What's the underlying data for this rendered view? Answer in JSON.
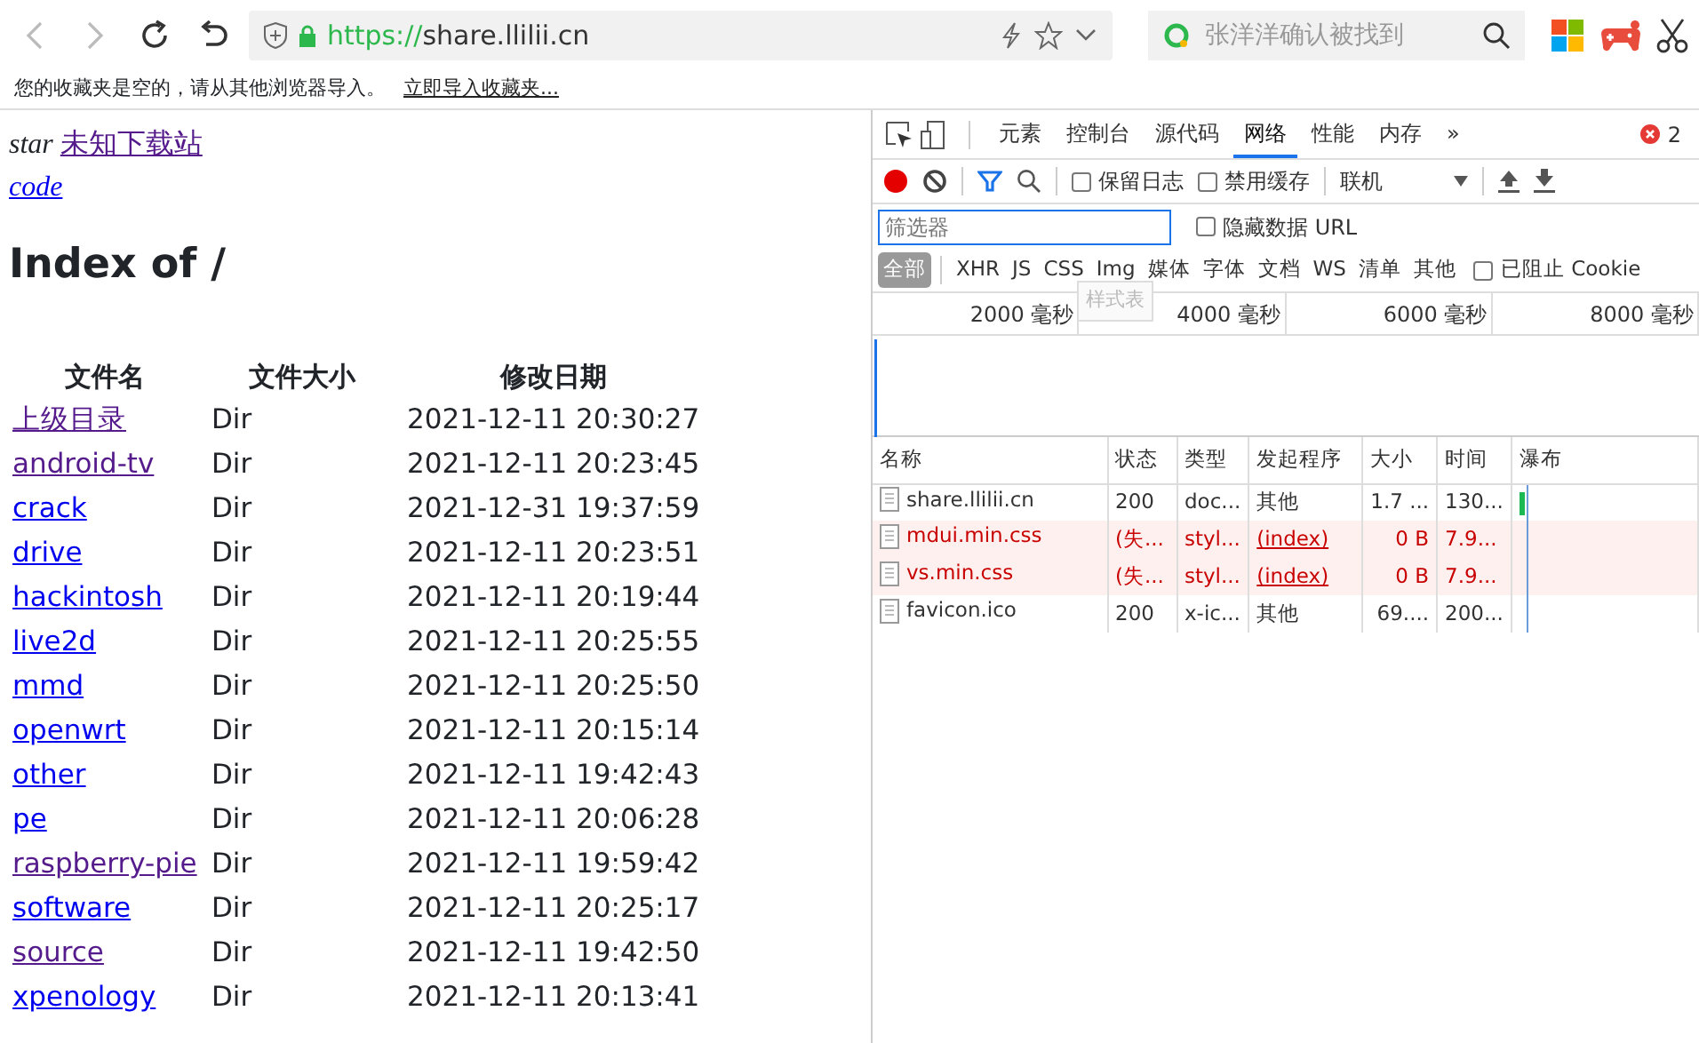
{
  "browser": {
    "url_scheme": "https://",
    "url_host": "share.llilii.cn",
    "search_placeholder": "张洋洋确认被找到"
  },
  "bookmarks_bar": {
    "message": "您的收藏夹是空的，请从其他浏览器导入。",
    "link": "立即导入收藏夹..."
  },
  "page": {
    "intro_text": "star",
    "intro_link": {
      "text": "未知下载站",
      "visited": true
    },
    "code_link": {
      "text": "code",
      "visited": false
    },
    "heading": "Index of /",
    "columns": [
      "文件名",
      "文件大小",
      "修改日期"
    ],
    "rows": [
      {
        "name": "上级目录",
        "visited": true,
        "size": "Dir",
        "date": "2021-12-11 20:30:27"
      },
      {
        "name": "android-tv",
        "visited": true,
        "size": "Dir",
        "date": "2021-12-11 20:23:45"
      },
      {
        "name": "crack",
        "visited": false,
        "size": "Dir",
        "date": "2021-12-31 19:37:59"
      },
      {
        "name": "drive",
        "visited": false,
        "size": "Dir",
        "date": "2021-12-11 20:23:51"
      },
      {
        "name": "hackintosh",
        "visited": false,
        "size": "Dir",
        "date": "2021-12-11 20:19:44"
      },
      {
        "name": "live2d",
        "visited": false,
        "size": "Dir",
        "date": "2021-12-11 20:25:55"
      },
      {
        "name": "mmd",
        "visited": false,
        "size": "Dir",
        "date": "2021-12-11 20:25:50"
      },
      {
        "name": "openwrt",
        "visited": false,
        "size": "Dir",
        "date": "2021-12-11 20:15:14"
      },
      {
        "name": "other",
        "visited": false,
        "size": "Dir",
        "date": "2021-12-11 19:42:43"
      },
      {
        "name": "pe",
        "visited": false,
        "size": "Dir",
        "date": "2021-12-11 20:06:28"
      },
      {
        "name": "raspberry-pie",
        "visited": true,
        "size": "Dir",
        "date": "2021-12-11 19:59:42"
      },
      {
        "name": "software",
        "visited": false,
        "size": "Dir",
        "date": "2021-12-11 20:25:17"
      },
      {
        "name": "source",
        "visited": true,
        "size": "Dir",
        "date": "2021-12-11 19:42:50"
      },
      {
        "name": "xpenology",
        "visited": false,
        "size": "Dir",
        "date": "2021-12-11 20:13:41"
      }
    ]
  },
  "devtools": {
    "tabs": [
      {
        "label": "元素",
        "selected": false
      },
      {
        "label": "控制台",
        "selected": false
      },
      {
        "label": "源代码",
        "selected": false
      },
      {
        "label": "网络",
        "selected": true
      },
      {
        "label": "性能",
        "selected": false
      },
      {
        "label": "内存",
        "selected": false
      }
    ],
    "more": "»",
    "error_count": "2",
    "preserve_log": {
      "label": "保留日志",
      "checked": false
    },
    "disable_cache": {
      "label": "禁用缓存",
      "checked": false
    },
    "throttle": "联机",
    "filter_placeholder": "筛选器",
    "hide_data_urls": {
      "label": "隐藏数据 URL",
      "checked": false
    },
    "type_filters": [
      {
        "label": "全部",
        "selected": true
      },
      {
        "label": "XHR",
        "selected": false
      },
      {
        "label": "JS",
        "selected": false
      },
      {
        "label": "CSS",
        "selected": false
      },
      {
        "label": "Img",
        "selected": false
      },
      {
        "label": "媒体",
        "selected": false
      },
      {
        "label": "字体",
        "selected": false
      },
      {
        "label": "文档",
        "selected": false
      },
      {
        "label": "WS",
        "selected": false
      },
      {
        "label": "清单",
        "selected": false
      },
      {
        "label": "其他",
        "selected": false
      }
    ],
    "tooltip": "样式表",
    "blocked_cookies": {
      "label": "已阻止 Cookie",
      "checked": false
    },
    "timeline_ticks": [
      "2000 毫秒",
      "4000 毫秒",
      "6000 毫秒",
      "8000 毫秒"
    ],
    "columns": [
      "名称",
      "状态",
      "类型",
      "发起程序",
      "大小",
      "时间",
      "瀑布"
    ],
    "requests": [
      {
        "name": "share.llilii.cn",
        "status": "200",
        "type": "doc...",
        "initiator": "其他",
        "initiator_link": false,
        "size": "1.7 ...",
        "time": "130...",
        "failed": false
      },
      {
        "name": "mdui.min.css",
        "status": "(失...",
        "type": "styl...",
        "initiator": "(index)",
        "initiator_link": true,
        "size": "0 B",
        "time": "7.9...",
        "failed": true
      },
      {
        "name": "vs.min.css",
        "status": "(失...",
        "type": "styl...",
        "initiator": "(index)",
        "initiator_link": true,
        "size": "0 B",
        "time": "7.9...",
        "failed": true
      },
      {
        "name": "favicon.ico",
        "status": "200",
        "type": "x-ic...",
        "initiator": "其他",
        "initiator_link": false,
        "size": "69....",
        "time": "200...",
        "failed": false
      }
    ]
  }
}
